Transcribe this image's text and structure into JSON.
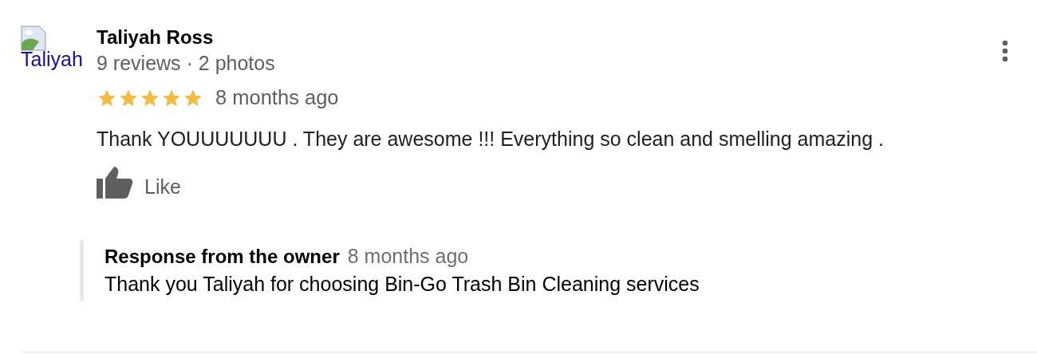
{
  "review": {
    "avatar_alt": "Taliyah",
    "author": "Taliyah Ross",
    "meta": "9 reviews · 2 photos",
    "stars": 5,
    "time": "8 months ago",
    "text": "Thank YOUUUUUUU . They are awesome !!! Everything so clean and smelling amazing .",
    "like_label": "Like"
  },
  "owner_response": {
    "title": "Response from the owner",
    "time": "8 months ago",
    "text": "Thank you Taliyah for choosing Bin-Go Trash Bin Cleaning services"
  }
}
